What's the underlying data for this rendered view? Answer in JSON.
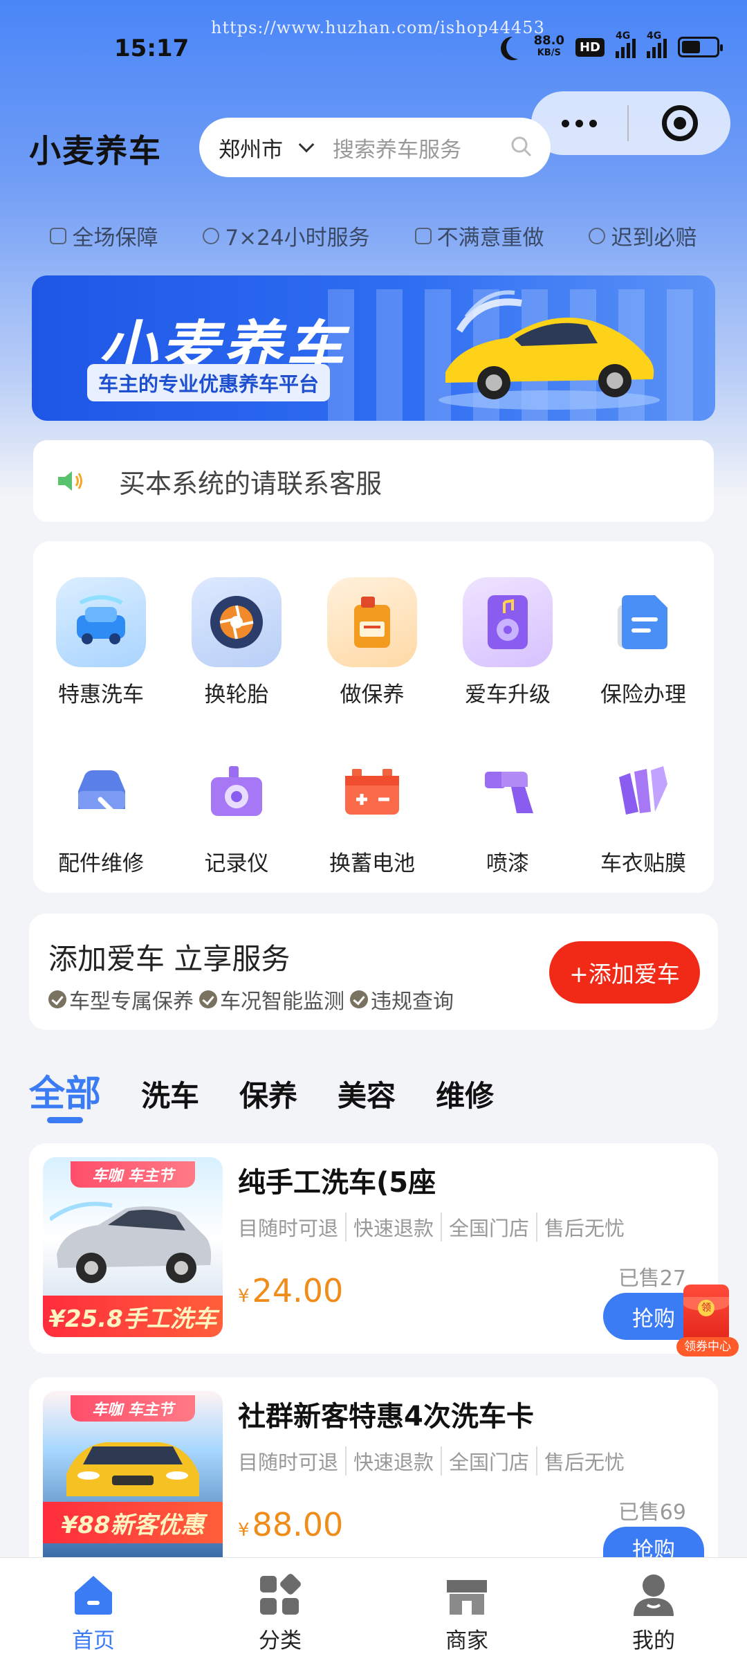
{
  "status_bar": {
    "time": "15:17",
    "watermark": "https://www.huzhan.com/ishop44453",
    "net_speed_value": "88.0",
    "net_speed_unit": "KB/S",
    "hd_badge": "HD",
    "signal1": "4G",
    "signal2": "4G",
    "battery_level": 0.55
  },
  "header": {
    "app_title": "小麦养车",
    "city": "郑州市",
    "search_placeholder": "搜索养车服务"
  },
  "guarantees": [
    {
      "label": "全场保障",
      "icon": "shield-icon"
    },
    {
      "label": "7×24小时服务",
      "icon": "clock-icon"
    },
    {
      "label": "不满意重做",
      "icon": "receipt-icon"
    },
    {
      "label": "迟到必赔",
      "icon": "yen-icon"
    }
  ],
  "banner": {
    "title": "小麦养车",
    "subtitle": "车主的专业优惠养车平台"
  },
  "notice": {
    "text": "买本系统的请联系客服"
  },
  "services": [
    {
      "label": "特惠洗车",
      "icon": "car-wash-icon"
    },
    {
      "label": "换轮胎",
      "icon": "tire-icon"
    },
    {
      "label": "做保养",
      "icon": "oil-can-icon"
    },
    {
      "label": "爱车升级",
      "icon": "speaker-upgrade-icon"
    },
    {
      "label": "保险办理",
      "icon": "document-icon"
    },
    {
      "label": "配件维修",
      "icon": "car-repair-icon"
    },
    {
      "label": "记录仪",
      "icon": "dashcam-icon"
    },
    {
      "label": "换蓄电池",
      "icon": "battery-icon"
    },
    {
      "label": "喷漆",
      "icon": "spray-gun-icon"
    },
    {
      "label": "车衣贴膜",
      "icon": "film-icon"
    }
  ],
  "add_car": {
    "title": "添加爱车 立享服务",
    "features": [
      "车型专属保养",
      "车况智能监测",
      "违规查询"
    ],
    "button": "+添加爱车"
  },
  "tabs": [
    "全部",
    "洗车",
    "保养",
    "美容",
    "维修"
  ],
  "products": [
    {
      "name": "纯手工洗车(5座",
      "tags": [
        "目随时可退",
        "快速退款",
        "全国门店",
        "售后无忧"
      ],
      "currency": "¥",
      "price": "24.00",
      "sold": "已售27",
      "buy": "抢购",
      "img_top_badge": "车咖 车主节",
      "img_ribbon": "¥25.8手工洗车"
    },
    {
      "name": "社群新客特惠4次洗车卡",
      "tags": [
        "目随时可退",
        "快速退款",
        "全国门店",
        "售后无忧"
      ],
      "currency": "¥",
      "price": "88.00",
      "sold": "已售69",
      "buy": "抢购",
      "img_top_badge": "车咖 车主节",
      "img_ribbon": "¥88新客优惠"
    }
  ],
  "coupon_float": {
    "envelope_char": "领",
    "label": "领券中心"
  },
  "tabbar": [
    {
      "label": "首页",
      "icon": "home-icon",
      "active": true
    },
    {
      "label": "分类",
      "icon": "category-icon",
      "active": false
    },
    {
      "label": "商家",
      "icon": "store-icon",
      "active": false
    },
    {
      "label": "我的",
      "icon": "user-icon",
      "active": false
    }
  ],
  "colors": {
    "brand_blue": "#3b7cf5",
    "accent_red": "#f02a17",
    "price_orange": "#f08c1a"
  }
}
